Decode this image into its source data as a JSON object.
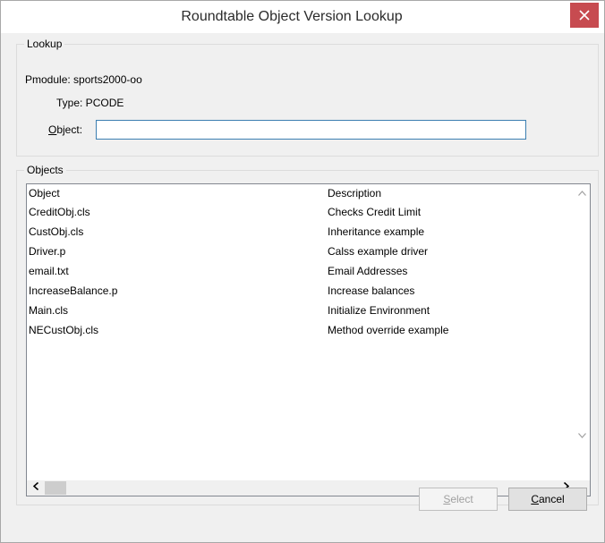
{
  "window": {
    "title": "Roundtable Object Version Lookup",
    "close_symbol": "✕"
  },
  "lookup": {
    "group_label": "Lookup",
    "pmodule_label": "Pmodule: sports2000-oo",
    "type_label": "Type: PCODE",
    "object_label_mnemonic": "O",
    "object_label_rest": "bject:",
    "object_value": ""
  },
  "objects": {
    "group_label": "Objects",
    "columns": [
      "Object",
      "Description"
    ],
    "rows": [
      {
        "object": "CreditObj.cls",
        "description": "Checks Credit Limit"
      },
      {
        "object": "CustObj.cls",
        "description": "Inheritance example"
      },
      {
        "object": "Driver.p",
        "description": "Calss example driver"
      },
      {
        "object": "email.txt",
        "description": "Email Addresses"
      },
      {
        "object": "IncreaseBalance.p",
        "description": "Increase balances"
      },
      {
        "object": "Main.cls",
        "description": "Initialize Environment"
      },
      {
        "object": "NECustObj.cls",
        "description": "Method override example"
      }
    ]
  },
  "buttons": {
    "select_mnemonic": "S",
    "select_rest": "elect",
    "cancel_mnemonic": "C",
    "cancel_rest": "ancel"
  },
  "icons": {
    "close": "close-icon",
    "scroll_up": "chevron-up-icon",
    "scroll_down": "chevron-down-icon",
    "scroll_left": "chevron-left-icon",
    "scroll_right": "chevron-right-icon"
  },
  "colors": {
    "close_button": "#c74b50",
    "input_border": "#3c7fb1",
    "dialog_bg": "#f0f0f0"
  }
}
